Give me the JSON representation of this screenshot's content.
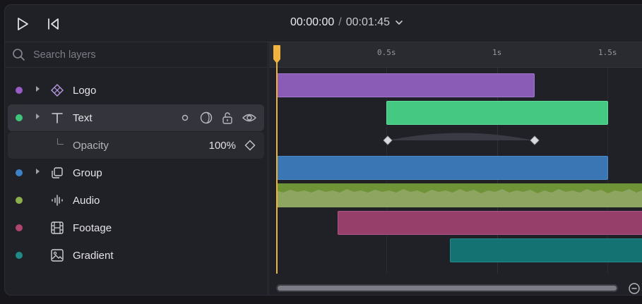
{
  "transport": {
    "current_time": "00:00:00",
    "separator": "/",
    "total_time": "00:01:45"
  },
  "search": {
    "placeholder": "Search layers"
  },
  "layers": [
    {
      "name": "Logo",
      "color": "#9a5cc4",
      "icon": "component-icon"
    },
    {
      "name": "Text",
      "color": "#3fc47a",
      "icon": "text-icon",
      "selected": true
    },
    {
      "name": "Group",
      "color": "#3d82c6",
      "icon": "group-icon"
    },
    {
      "name": "Audio",
      "color": "#8ab04e",
      "icon": "audio-icon"
    },
    {
      "name": "Footage",
      "color": "#b0456f",
      "icon": "film-icon"
    },
    {
      "name": "Gradient",
      "color": "#1f8a88",
      "icon": "image-icon"
    }
  ],
  "property": {
    "name": "Opacity",
    "value": "100%"
  },
  "ruler": {
    "ticks": [
      "0.5s",
      "1s",
      "1.5s"
    ]
  },
  "colors": {
    "accent": "#f0b43c",
    "logo_clip": "#8a5cb6",
    "text_clip": "#44c882",
    "group_clip": "#3a76b3",
    "audio_clip": "#8ea562",
    "footage_clip": "#963f6b",
    "gradient_clip": "#157272"
  }
}
